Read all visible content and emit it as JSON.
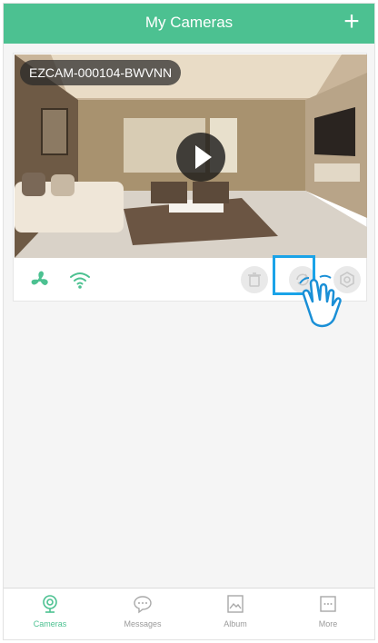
{
  "header": {
    "title": "My Cameras",
    "add_icon": "plus-icon"
  },
  "camera": {
    "name": "EZCAM-000104-BWVNN",
    "play_icon": "play-icon",
    "toolbar_icons": [
      "fan-icon",
      "wifi-icon",
      "trash-icon",
      "refresh-icon",
      "settings-icon"
    ]
  },
  "tabs": [
    {
      "label": "Cameras",
      "icon": "camera-icon",
      "active": true
    },
    {
      "label": "Messages",
      "icon": "chat-icon",
      "active": false
    },
    {
      "label": "Album",
      "icon": "image-icon",
      "active": false
    },
    {
      "label": "More",
      "icon": "more-icon",
      "active": false
    }
  ],
  "colors": {
    "accent": "#4cc191",
    "highlight": "#1aa3e8",
    "inactive": "#9a9a9a"
  }
}
